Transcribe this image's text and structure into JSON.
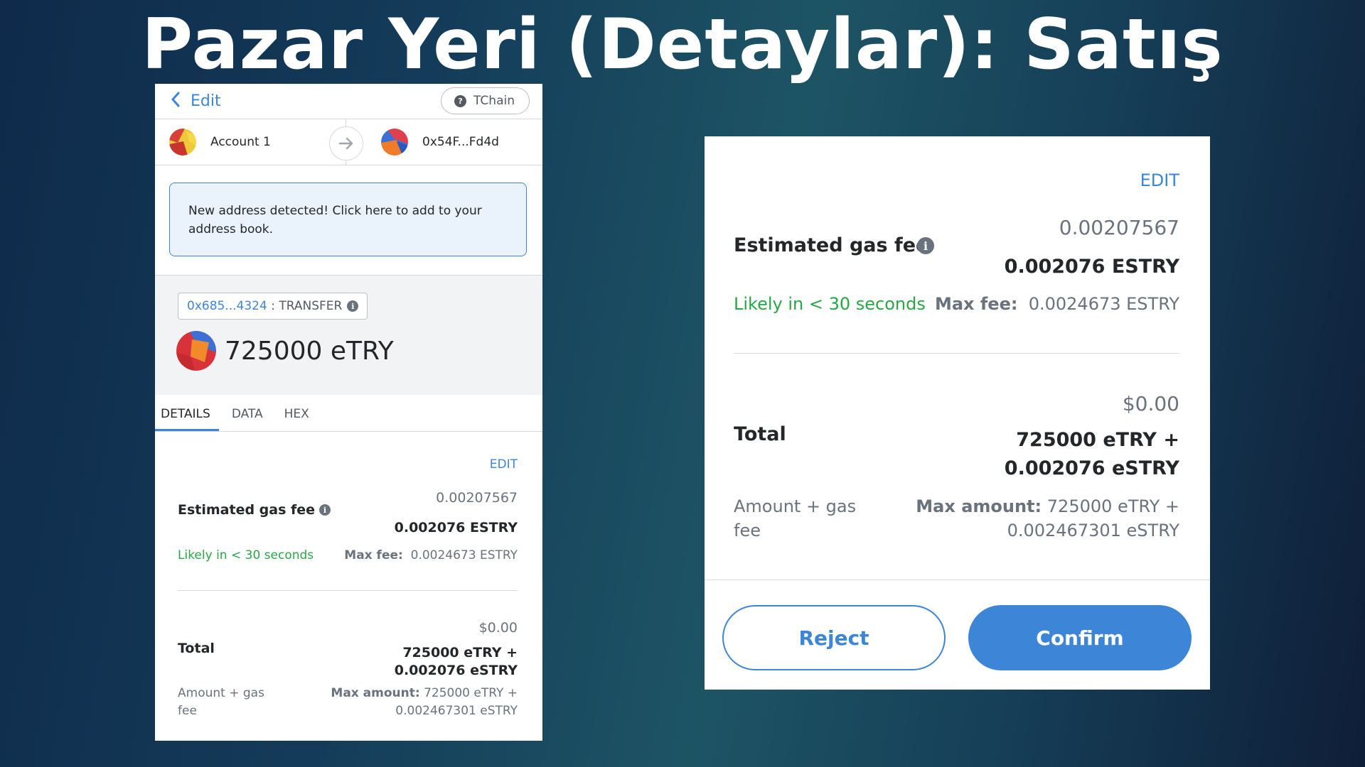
{
  "slide": {
    "title": "Pazar Yeri (Detaylar): Satış"
  },
  "left": {
    "header": {
      "back_icon": "chevron-left-icon",
      "edit_label": "Edit",
      "network": "TChain"
    },
    "from_account": "Account 1",
    "to_account": "0x54F...Fd4d",
    "notice": "New address detected! Click here to add to your address book.",
    "method": {
      "address": "0x685...4324",
      "separator": " : ",
      "name": "TRANSFER"
    },
    "amount": "725000 eTRY",
    "tabs": [
      "DETAILS",
      "DATA",
      "HEX"
    ],
    "details": {
      "edit": "EDIT",
      "gas_label": "Estimated gas fee",
      "gas_value_fiat": "0.00207567",
      "gas_value": "0.002076 ESTRY",
      "likely": "Likely in < 30 seconds",
      "max_fee_label": "Max fee:",
      "max_fee_value": "0.0024673 ESTRY",
      "total_label": "Total",
      "total_fiat": "$0.00",
      "total_line1": "725000 eTRY +",
      "total_line2": "0.002076 eSTRY",
      "amount_gas_label_1": "Amount + gas",
      "amount_gas_label_2": "fee",
      "max_amount_label": "Max amount:",
      "max_amount_line1": "725000 eTRY +",
      "max_amount_line2": "0.002467301 eSTRY"
    }
  },
  "right": {
    "edit": "EDIT",
    "gas_label": "Estimated gas fee",
    "gas_value_fiat": "0.00207567",
    "gas_value": "0.002076 ESTRY",
    "likely": "Likely in < 30 seconds",
    "max_fee_label": "Max fee:",
    "max_fee_value": "0.0024673 ESTRY",
    "total_label": "Total",
    "total_fiat": "$0.00",
    "total_line1": "725000 eTRY +",
    "total_line2": "0.002076 eSTRY",
    "amount_gas_label_1": "Amount + gas",
    "amount_gas_label_2": "fee",
    "max_amount_label": "Max amount:",
    "max_amount_line1": "725000 eTRY +",
    "max_amount_line2": "0.002467301 eSTRY",
    "reject": "Reject",
    "confirm": "Confirm"
  },
  "colors": {
    "accent": "#3d85d6",
    "green": "#28a745",
    "text": "#24272a",
    "muted": "#6a737d"
  }
}
